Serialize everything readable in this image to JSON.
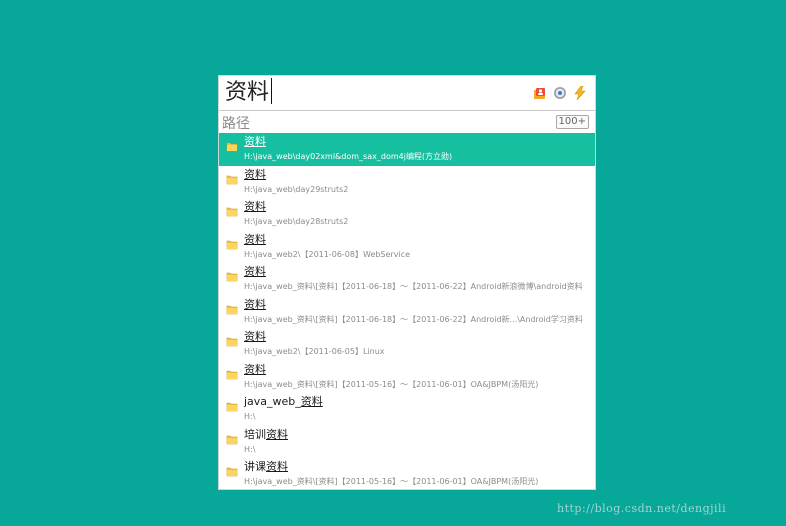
{
  "search": {
    "query": "资料"
  },
  "toolbar": {
    "icons": [
      "contacts-icon",
      "settings-icon",
      "lightning-icon"
    ]
  },
  "path_row": {
    "label": "路径",
    "count": "100+"
  },
  "results": [
    {
      "prefix": "",
      "match": "资料",
      "path": "H:\\java_web\\day02xml&dom_sax_dom4j编程(方立勋)",
      "selected": true
    },
    {
      "prefix": "",
      "match": "资料",
      "path": "H:\\java_web\\day29struts2",
      "selected": false
    },
    {
      "prefix": "",
      "match": "资料",
      "path": "H:\\java_web\\day28struts2",
      "selected": false
    },
    {
      "prefix": "",
      "match": "资料",
      "path": "H:\\java_web2\\【2011-06-08】WebService",
      "selected": false
    },
    {
      "prefix": "",
      "match": "资料",
      "path": "H:\\java_web_资料\\[资料]【2011-06-18】～【2011-06-22】Android新浪微博\\android资料",
      "selected": false
    },
    {
      "prefix": "",
      "match": "资料",
      "path": "H:\\java_web_资料\\[资料]【2011-06-18】～【2011-06-22】Android新...\\Android学习资料",
      "selected": false
    },
    {
      "prefix": "",
      "match": "资料",
      "path": "H:\\java_web2\\【2011-06-05】Linux",
      "selected": false
    },
    {
      "prefix": "",
      "match": "资料",
      "path": "H:\\java_web_资料\\[资料]【2011-05-16】～【2011-06-01】OA&JBPM(汤阳光)",
      "selected": false
    },
    {
      "prefix": "java_web_",
      "match": "资料",
      "path": "H:\\",
      "selected": false
    },
    {
      "prefix": "培训",
      "match": "资料",
      "path": "H:\\",
      "selected": false
    },
    {
      "prefix": "讲课",
      "match": "资料",
      "path": "H:\\java_web_资料\\[资料]【2011-05-16】～【2011-06-01】OA&JBPM(汤阳光)",
      "selected": false
    }
  ],
  "watermark": "http://blog.csdn.net/dengjili"
}
